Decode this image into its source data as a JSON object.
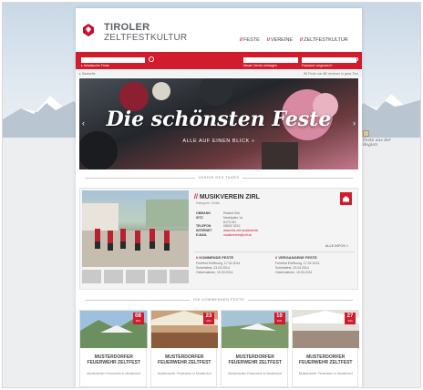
{
  "header": {
    "brand_line1": "TIROLER",
    "brand_line2": "ZELTFESTKULTUR",
    "nav": [
      "FESTE",
      "VEREINE",
      "ZELTFESTKULTUR"
    ]
  },
  "searchbar": {
    "label_main": "▸ Detailsuche Feste",
    "label_mid": "Neuen Verein eintragen",
    "label_right": "Passwort vergessen?"
  },
  "crumb": {
    "left": "▸ Startseite",
    "right": "86 Feste von 88 Vereinen in ganz Tirol"
  },
  "hero": {
    "title": "Die schönsten Feste",
    "subtitle": "ALLE AUF EINEN BLICK »"
  },
  "side_note": "Feste aus der Region",
  "sections": {
    "club_of_day": "VEREIN DES TAGES",
    "upcoming": "DIE KOMMENDEN FESTE"
  },
  "club": {
    "name": "MUSIKVEREIN ZIRL",
    "location": "Kategorie: Musik",
    "info": [
      {
        "k": "OBMANN",
        "v": "Roland Kirk",
        "link": false
      },
      {
        "k": "SITZ",
        "v": "Marktplatz 1a",
        "link": false
      },
      {
        "k": "",
        "v": "6170 Zirl",
        "link": false
      },
      {
        "k": "TELEFON",
        "v": "05632 3212",
        "link": false
      },
      {
        "k": "INTERNET",
        "v": "www.mk-zirl.musikverein",
        "link": true
      },
      {
        "k": "E-MAIL",
        "v": "musikverein@zirl.at",
        "link": true
      }
    ],
    "alle_infos": "ALLE INFOS »",
    "upcoming_title": "KOMMENDE FESTE",
    "upcoming": [
      "Fernfest Eröffnung, 17.02.2014",
      "Schiefafest, 23.03.2014",
      "Ostermatinee, 19.03.2014"
    ],
    "past_title": "VERGANGENE FESTE",
    "past": [
      "Fernfest Eröffnung, 17.02.2014",
      "Schiefafest, 23.03.2014",
      "Ostermatinee, 19.03.2014"
    ]
  },
  "fests": [
    {
      "day": "08",
      "month": "MAI",
      "title": "MUSTERDORFER FEUERWEHR ZELTFEST",
      "sub": "Musterdorfer Feuerwehr in Musterdorf"
    },
    {
      "day": "23",
      "month": "MAI",
      "title": "MUSTERDORFER FEUERWEHR ZELTFEST",
      "sub": "Musterdorfer Feuerwehr in Musterdorf"
    },
    {
      "day": "10",
      "month": "JUN",
      "title": "MUSTERDORFER FEUERWEHR ZELTFEST",
      "sub": "Musterdorfer Feuerwehr in Musterdorf"
    },
    {
      "day": "27",
      "month": "JUN",
      "title": "MUSTERDORFER FEUERWEHR ZELTFEST",
      "sub": "Musterdorfer Feuerwehr in Musterdorf"
    }
  ],
  "colors": {
    "accent": "#d01c2c",
    "text": "#444444"
  }
}
